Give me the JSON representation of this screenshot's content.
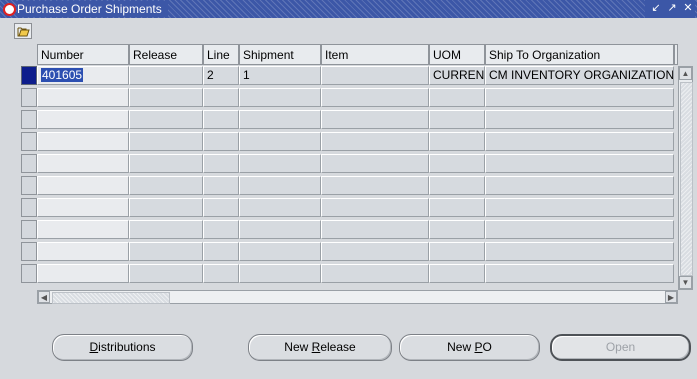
{
  "window": {
    "title": "Purchase Order Shipments",
    "controls": [
      "minimize",
      "maximize",
      "close"
    ]
  },
  "toolbar": {
    "icon": "folder-open-icon"
  },
  "table": {
    "columns": [
      "Number",
      "Release",
      "Line",
      "Shipment",
      "Item",
      "UOM",
      "Ship To Organization"
    ],
    "rows": [
      [
        "401605",
        "",
        "2",
        "1",
        "",
        "CURREN",
        "CM INVENTORY ORGANIZATION"
      ],
      [
        "",
        "",
        "",
        "",
        "",
        "",
        ""
      ],
      [
        "",
        "",
        "",
        "",
        "",
        "",
        ""
      ],
      [
        "",
        "",
        "",
        "",
        "",
        "",
        ""
      ],
      [
        "",
        "",
        "",
        "",
        "",
        "",
        ""
      ],
      [
        "",
        "",
        "",
        "",
        "",
        "",
        ""
      ],
      [
        "",
        "",
        "",
        "",
        "",
        "",
        ""
      ],
      [
        "",
        "",
        "",
        "",
        "",
        "",
        ""
      ],
      [
        "",
        "",
        "",
        "",
        "",
        "",
        ""
      ],
      [
        "",
        "",
        "",
        "",
        "",
        "",
        ""
      ]
    ],
    "selected_row": 0
  },
  "buttons": {
    "distributions": {
      "label_pre": "",
      "mnemonic": "D",
      "label_post": "istributions"
    },
    "new_release": {
      "label_pre": "New ",
      "mnemonic": "R",
      "label_post": "elease"
    },
    "new_po": {
      "label_pre": "New ",
      "mnemonic": "P",
      "label_post": "O"
    },
    "open": {
      "label": "Open",
      "enabled": false
    }
  },
  "colors": {
    "titlebar": "#3c57a7",
    "selection": "#2c4fb1",
    "row_indicator_active": "#0d1d8c"
  }
}
